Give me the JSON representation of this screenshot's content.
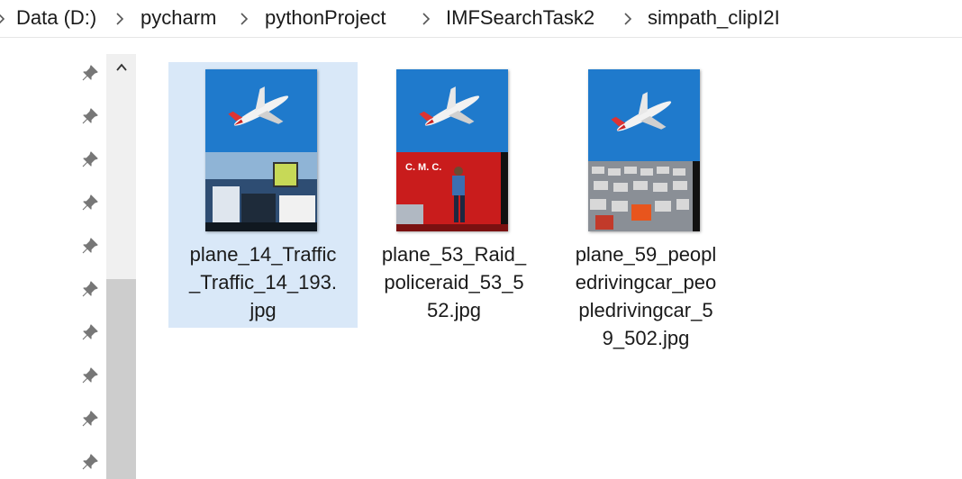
{
  "breadcrumb": {
    "items": [
      "Data (D:)",
      "pycharm",
      "pythonProject",
      "IMFSearchTask2",
      "simpath_clipI2I"
    ]
  },
  "files": [
    {
      "name_lines": [
        "plane_14_Traffic",
        "_Traffic_14_193.",
        "jpg"
      ],
      "selected": true,
      "bottom_scene": "traffic"
    },
    {
      "name_lines": [
        "plane_53_Raid_",
        "policeraid_53_5",
        "52.jpg"
      ],
      "selected": false,
      "bottom_scene": "police"
    },
    {
      "name_lines": [
        "plane_59_peopl",
        "edrivingcar_peo",
        "pledrivingcar_5",
        "9_502.jpg"
      ],
      "selected": false,
      "bottom_scene": "cars"
    }
  ],
  "thumb_caption_police": "C.  M.  C.",
  "colors": {
    "selection": "#d9e8f8",
    "sky": "#1f7acc",
    "scrollbar_thumb": "#cdcdcd"
  },
  "icons": {
    "pin": "pin-icon",
    "chevron": "chevron-right-icon",
    "scroll_up": "chevron-up-icon"
  }
}
